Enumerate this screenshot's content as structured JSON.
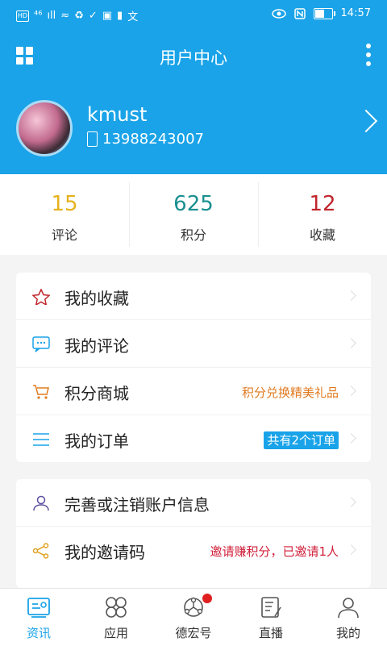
{
  "status_bar": {
    "left_items": [
      "HD",
      "⁴⁶",
      "ıll",
      "≈",
      "♻",
      "✓",
      "▣",
      "▮",
      "文"
    ],
    "time": "14:57",
    "battery_level": 0.55
  },
  "appbar": {
    "title": "用户中心"
  },
  "profile": {
    "username": "kmust",
    "phone": "13988243007"
  },
  "stats": [
    {
      "value": "15",
      "label": "评论",
      "color": "#e6b21d"
    },
    {
      "value": "625",
      "label": "积分",
      "color": "#1a8f8f"
    },
    {
      "value": "12",
      "label": "收藏",
      "color": "#c0262c"
    }
  ],
  "menu_group1": [
    {
      "label": "我的收藏",
      "icon": "star-icon",
      "extra": "",
      "extra_color": ""
    },
    {
      "label": "我的评论",
      "icon": "comment-icon",
      "extra": "",
      "extra_color": ""
    },
    {
      "label": "积分商城",
      "icon": "cart-icon",
      "extra": "积分兑换精美礼品",
      "extra_color": "#e07a1f"
    },
    {
      "label": "我的订单",
      "icon": "list-icon",
      "extra": "共有2个订单",
      "extra_color": "#ffffff"
    }
  ],
  "menu_group2": [
    {
      "label": "完善或注销账户信息",
      "icon": "user-icon",
      "extra": "",
      "extra_color": ""
    },
    {
      "label": "我的邀请码",
      "icon": "share-icon",
      "extra": "邀请赚积分，已邀请1人",
      "extra_color": "#d0203a"
    }
  ],
  "tabbar": [
    {
      "label": "资讯",
      "icon": "news-icon",
      "active": true
    },
    {
      "label": "应用",
      "icon": "apps-icon",
      "active": false
    },
    {
      "label": "德宏号",
      "icon": "network-icon",
      "active": false,
      "badge": true
    },
    {
      "label": "直播",
      "icon": "live-icon",
      "active": false
    },
    {
      "label": "我的",
      "icon": "profile-icon",
      "active": false
    }
  ],
  "colors": {
    "brand": "#1aa3e8"
  }
}
